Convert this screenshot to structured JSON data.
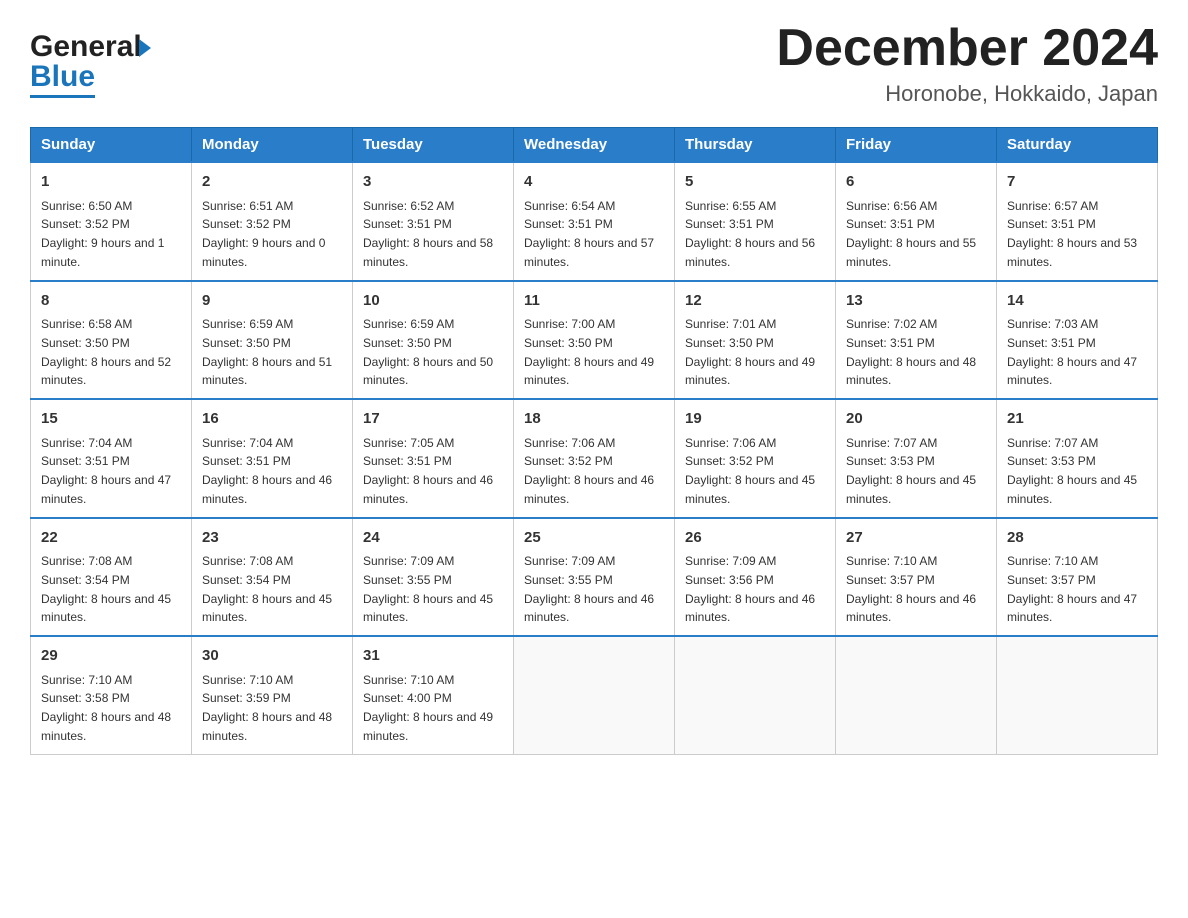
{
  "header": {
    "logo_general": "General",
    "logo_blue": "Blue",
    "month_title": "December 2024",
    "location": "Horonobe, Hokkaido, Japan"
  },
  "days_of_week": [
    "Sunday",
    "Monday",
    "Tuesday",
    "Wednesday",
    "Thursday",
    "Friday",
    "Saturday"
  ],
  "weeks": [
    [
      {
        "day": "1",
        "sunrise": "6:50 AM",
        "sunset": "3:52 PM",
        "daylight": "9 hours and 1 minute."
      },
      {
        "day": "2",
        "sunrise": "6:51 AM",
        "sunset": "3:52 PM",
        "daylight": "9 hours and 0 minutes."
      },
      {
        "day": "3",
        "sunrise": "6:52 AM",
        "sunset": "3:51 PM",
        "daylight": "8 hours and 58 minutes."
      },
      {
        "day": "4",
        "sunrise": "6:54 AM",
        "sunset": "3:51 PM",
        "daylight": "8 hours and 57 minutes."
      },
      {
        "day": "5",
        "sunrise": "6:55 AM",
        "sunset": "3:51 PM",
        "daylight": "8 hours and 56 minutes."
      },
      {
        "day": "6",
        "sunrise": "6:56 AM",
        "sunset": "3:51 PM",
        "daylight": "8 hours and 55 minutes."
      },
      {
        "day": "7",
        "sunrise": "6:57 AM",
        "sunset": "3:51 PM",
        "daylight": "8 hours and 53 minutes."
      }
    ],
    [
      {
        "day": "8",
        "sunrise": "6:58 AM",
        "sunset": "3:50 PM",
        "daylight": "8 hours and 52 minutes."
      },
      {
        "day": "9",
        "sunrise": "6:59 AM",
        "sunset": "3:50 PM",
        "daylight": "8 hours and 51 minutes."
      },
      {
        "day": "10",
        "sunrise": "6:59 AM",
        "sunset": "3:50 PM",
        "daylight": "8 hours and 50 minutes."
      },
      {
        "day": "11",
        "sunrise": "7:00 AM",
        "sunset": "3:50 PM",
        "daylight": "8 hours and 49 minutes."
      },
      {
        "day": "12",
        "sunrise": "7:01 AM",
        "sunset": "3:50 PM",
        "daylight": "8 hours and 49 minutes."
      },
      {
        "day": "13",
        "sunrise": "7:02 AM",
        "sunset": "3:51 PM",
        "daylight": "8 hours and 48 minutes."
      },
      {
        "day": "14",
        "sunrise": "7:03 AM",
        "sunset": "3:51 PM",
        "daylight": "8 hours and 47 minutes."
      }
    ],
    [
      {
        "day": "15",
        "sunrise": "7:04 AM",
        "sunset": "3:51 PM",
        "daylight": "8 hours and 47 minutes."
      },
      {
        "day": "16",
        "sunrise": "7:04 AM",
        "sunset": "3:51 PM",
        "daylight": "8 hours and 46 minutes."
      },
      {
        "day": "17",
        "sunrise": "7:05 AM",
        "sunset": "3:51 PM",
        "daylight": "8 hours and 46 minutes."
      },
      {
        "day": "18",
        "sunrise": "7:06 AM",
        "sunset": "3:52 PM",
        "daylight": "8 hours and 46 minutes."
      },
      {
        "day": "19",
        "sunrise": "7:06 AM",
        "sunset": "3:52 PM",
        "daylight": "8 hours and 45 minutes."
      },
      {
        "day": "20",
        "sunrise": "7:07 AM",
        "sunset": "3:53 PM",
        "daylight": "8 hours and 45 minutes."
      },
      {
        "day": "21",
        "sunrise": "7:07 AM",
        "sunset": "3:53 PM",
        "daylight": "8 hours and 45 minutes."
      }
    ],
    [
      {
        "day": "22",
        "sunrise": "7:08 AM",
        "sunset": "3:54 PM",
        "daylight": "8 hours and 45 minutes."
      },
      {
        "day": "23",
        "sunrise": "7:08 AM",
        "sunset": "3:54 PM",
        "daylight": "8 hours and 45 minutes."
      },
      {
        "day": "24",
        "sunrise": "7:09 AM",
        "sunset": "3:55 PM",
        "daylight": "8 hours and 45 minutes."
      },
      {
        "day": "25",
        "sunrise": "7:09 AM",
        "sunset": "3:55 PM",
        "daylight": "8 hours and 46 minutes."
      },
      {
        "day": "26",
        "sunrise": "7:09 AM",
        "sunset": "3:56 PM",
        "daylight": "8 hours and 46 minutes."
      },
      {
        "day": "27",
        "sunrise": "7:10 AM",
        "sunset": "3:57 PM",
        "daylight": "8 hours and 46 minutes."
      },
      {
        "day": "28",
        "sunrise": "7:10 AM",
        "sunset": "3:57 PM",
        "daylight": "8 hours and 47 minutes."
      }
    ],
    [
      {
        "day": "29",
        "sunrise": "7:10 AM",
        "sunset": "3:58 PM",
        "daylight": "8 hours and 48 minutes."
      },
      {
        "day": "30",
        "sunrise": "7:10 AM",
        "sunset": "3:59 PM",
        "daylight": "8 hours and 48 minutes."
      },
      {
        "day": "31",
        "sunrise": "7:10 AM",
        "sunset": "4:00 PM",
        "daylight": "8 hours and 49 minutes."
      },
      null,
      null,
      null,
      null
    ]
  ]
}
